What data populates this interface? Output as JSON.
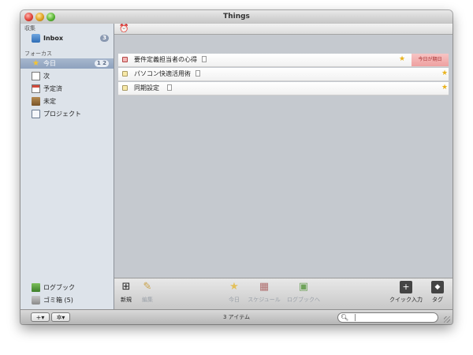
{
  "window": {
    "title": "Things"
  },
  "sidebar": {
    "collect_header": "収集",
    "focus_header": "フォーカス",
    "inbox": {
      "label": "Inbox",
      "count": "3"
    },
    "today": {
      "label": "今日",
      "count": "1 2"
    },
    "next": {
      "label": "次"
    },
    "scheduled": {
      "label": "予定済"
    },
    "someday": {
      "label": "未定"
    },
    "projects": {
      "label": "プロジェクト"
    },
    "logbook": {
      "label": "ログブック"
    },
    "trash": {
      "label": "ゴミ箱 (5)"
    }
  },
  "tasks": [
    {
      "title": "要件定義担当者の心得",
      "due": "今日が期日",
      "starred": true,
      "color": "#f3b6b6"
    },
    {
      "title": "パソコン快適活用術",
      "due": "",
      "starred": true,
      "color": "#f8e9a8"
    },
    {
      "title": "同期設定",
      "due": "",
      "starred": true,
      "color": "#f8e9a8"
    }
  ],
  "toolbar": {
    "new": "新規",
    "edit": "編集",
    "today": "今日",
    "schedule": "スケジュール",
    "to_logbook": "ログブックへ",
    "quick_entry": "クイック入力",
    "tag": "タグ"
  },
  "statusbar": {
    "add_button": "+▾",
    "gear_button": "✲▾",
    "item_count": "3 アイテム",
    "search_value": ""
  },
  "icons": {
    "alarm": "alarm-clock-icon",
    "star": "star-icon",
    "search": "magnifier-icon"
  },
  "colors": {
    "selection": "#8ea2be",
    "star": "#e9b21b",
    "due_badge": "#eea0a0"
  }
}
